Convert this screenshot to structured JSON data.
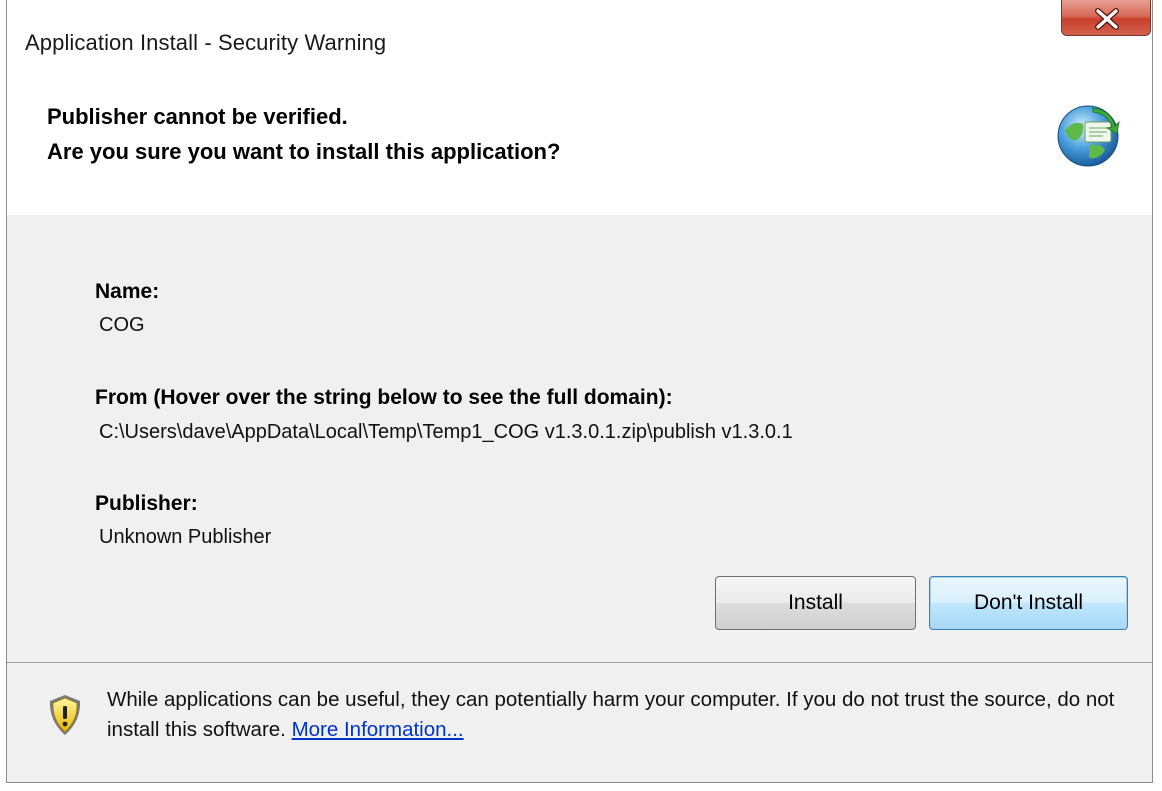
{
  "window": {
    "title": "Application Install - Security Warning",
    "close_icon": "close-icon"
  },
  "header": {
    "line1": "Publisher cannot be verified.",
    "line2": "Are you sure you want to install this application?",
    "icon": "globe-install-icon"
  },
  "details": {
    "name_label": "Name:",
    "name_value": "COG",
    "from_label": "From (Hover over the string below to see the full domain):",
    "from_value": "C:\\Users\\dave\\AppData\\Local\\Temp\\Temp1_COG v1.3.0.1.zip\\publish v1.3.0.1",
    "publisher_label": "Publisher:",
    "publisher_value": "Unknown Publisher"
  },
  "buttons": {
    "install": "Install",
    "dont_install": "Don't Install"
  },
  "footer": {
    "warning_text": "While applications can be useful, they can potentially harm your computer. If you do not trust the source, do not install this software.",
    "more_info_link": "More Information...",
    "icon": "warning-shield-icon"
  },
  "colors": {
    "close_button": "#d04a36",
    "link": "#0033cc",
    "panel_bg": "#f0f0f0"
  }
}
